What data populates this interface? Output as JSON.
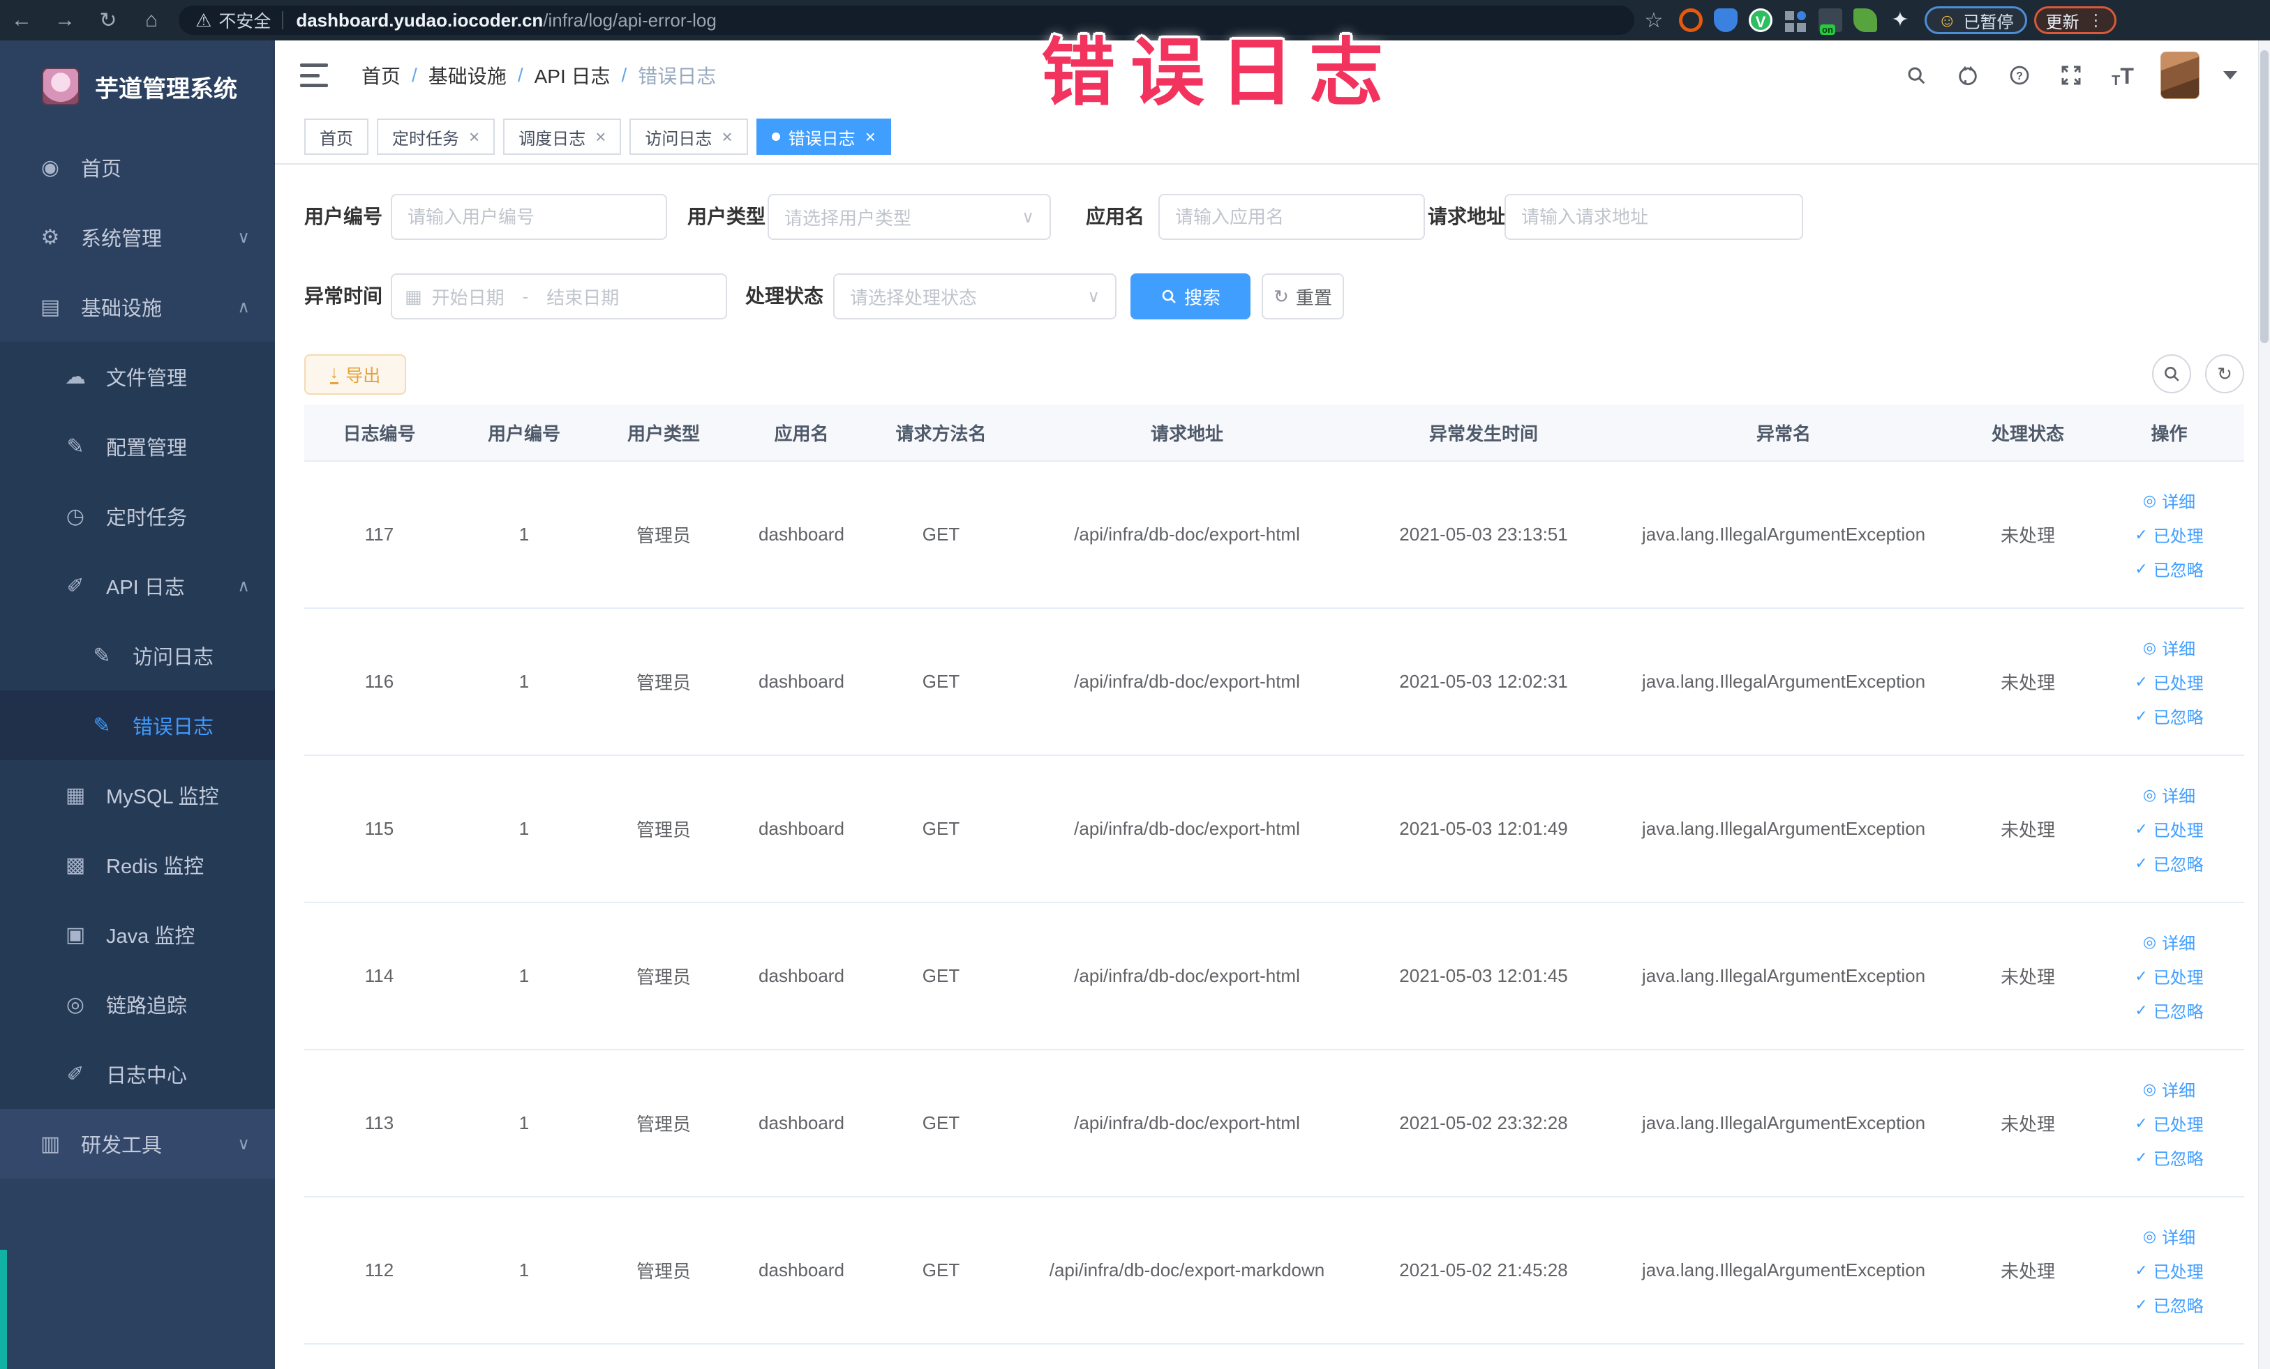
{
  "browser": {
    "security_label": "不安全",
    "url_domain": "dashboard.yudao.iocoder.cn",
    "url_path": "/infra/log/api-error-log",
    "paused_badge": "已暂停",
    "update_button": "更新"
  },
  "annotation": {
    "text": "错误日志",
    "color": "#f2335d"
  },
  "sidebar": {
    "title": "芋道管理系统",
    "items": [
      {
        "label": "首页"
      },
      {
        "label": "系统管理"
      },
      {
        "label": "基础设施"
      },
      {
        "label": "文件管理"
      },
      {
        "label": "配置管理"
      },
      {
        "label": "定时任务"
      },
      {
        "label": "API 日志"
      },
      {
        "label": "访问日志"
      },
      {
        "label": "错误日志"
      },
      {
        "label": "MySQL 监控"
      },
      {
        "label": "Redis 监控"
      },
      {
        "label": "Java 监控"
      },
      {
        "label": "链路追踪"
      },
      {
        "label": "日志中心"
      },
      {
        "label": "研发工具"
      }
    ]
  },
  "header": {
    "breadcrumb": [
      "首页",
      "基础设施",
      "API 日志",
      "错误日志"
    ],
    "separator": "/"
  },
  "tabs": {
    "items": [
      {
        "label": "首页"
      },
      {
        "label": "定时任务"
      },
      {
        "label": "调度日志"
      },
      {
        "label": "访问日志"
      },
      {
        "label": "错误日志"
      }
    ]
  },
  "filters": {
    "user_id": {
      "label": "用户编号",
      "placeholder": "请输入用户编号"
    },
    "user_type": {
      "label": "用户类型",
      "placeholder": "请选择用户类型"
    },
    "app_name": {
      "label": "应用名",
      "placeholder": "请输入应用名"
    },
    "request_url": {
      "label": "请求地址",
      "placeholder": "请输入请求地址"
    },
    "exception_time": {
      "label": "异常时间",
      "start_placeholder": "开始日期",
      "end_placeholder": "结束日期",
      "separator": "-"
    },
    "process_status": {
      "label": "处理状态",
      "placeholder": "请选择处理状态"
    },
    "search_label": "搜索",
    "reset_label": "重置"
  },
  "toolbar": {
    "export_label": "导出"
  },
  "table": {
    "headers": [
      "日志编号",
      "用户编号",
      "用户类型",
      "应用名",
      "请求方法名",
      "请求地址",
      "异常发生时间",
      "异常名",
      "处理状态",
      "操作"
    ],
    "action_labels": [
      "详细",
      "已处理",
      "已忽略"
    ],
    "rows": [
      {
        "id": "117",
        "user_id": "1",
        "user_type": "管理员",
        "app": "dashboard",
        "method": "GET",
        "url": "/api/infra/db-doc/export-html",
        "time": "2021-05-03 23:13:51",
        "exception": "java.lang.IllegalArgumentException",
        "status": "未处理"
      },
      {
        "id": "116",
        "user_id": "1",
        "user_type": "管理员",
        "app": "dashboard",
        "method": "GET",
        "url": "/api/infra/db-doc/export-html",
        "time": "2021-05-03 12:02:31",
        "exception": "java.lang.IllegalArgumentException",
        "status": "未处理"
      },
      {
        "id": "115",
        "user_id": "1",
        "user_type": "管理员",
        "app": "dashboard",
        "method": "GET",
        "url": "/api/infra/db-doc/export-html",
        "time": "2021-05-03 12:01:49",
        "exception": "java.lang.IllegalArgumentException",
        "status": "未处理"
      },
      {
        "id": "114",
        "user_id": "1",
        "user_type": "管理员",
        "app": "dashboard",
        "method": "GET",
        "url": "/api/infra/db-doc/export-html",
        "time": "2021-05-03 12:01:45",
        "exception": "java.lang.IllegalArgumentException",
        "status": "未处理"
      },
      {
        "id": "113",
        "user_id": "1",
        "user_type": "管理员",
        "app": "dashboard",
        "method": "GET",
        "url": "/api/infra/db-doc/export-html",
        "time": "2021-05-02 23:32:28",
        "exception": "java.lang.IllegalArgumentException",
        "status": "未处理"
      },
      {
        "id": "112",
        "user_id": "1",
        "user_type": "管理员",
        "app": "dashboard",
        "method": "GET",
        "url": "/api/infra/db-doc/export-markdown",
        "time": "2021-05-02 21:45:28",
        "exception": "java.lang.IllegalArgumentException",
        "status": "未处理"
      }
    ]
  },
  "icons": {
    "back": "←",
    "forward": "→",
    "reload": "↻",
    "home": "⌂",
    "warning": "⚠",
    "star": "☆",
    "dots": "⋮",
    "face": "☺",
    "puzzle": "✦",
    "dashboard": "◉",
    "gear": "⚙",
    "infra": "▤",
    "cloud": "☁",
    "edit": "✎",
    "timer": "◷",
    "log": "✐",
    "mysql": "▦",
    "redis": "▩",
    "java": "▣",
    "trace": "◎",
    "tools": "▥",
    "chevron_down": "∨",
    "chevron_up": "∧",
    "close": "×",
    "calendar": "▦",
    "refresh": "↻",
    "download": "↓",
    "eye": "◎",
    "check": "✓",
    "question": "?",
    "font": "T"
  },
  "colors": {
    "accent": "#409eff",
    "warning_text": "#e6a23c",
    "annotation": "#f2335d",
    "sidebar_bg": "#2c405f",
    "submenu_bg": "#253a55",
    "chrome_bg": "#1d2935"
  }
}
